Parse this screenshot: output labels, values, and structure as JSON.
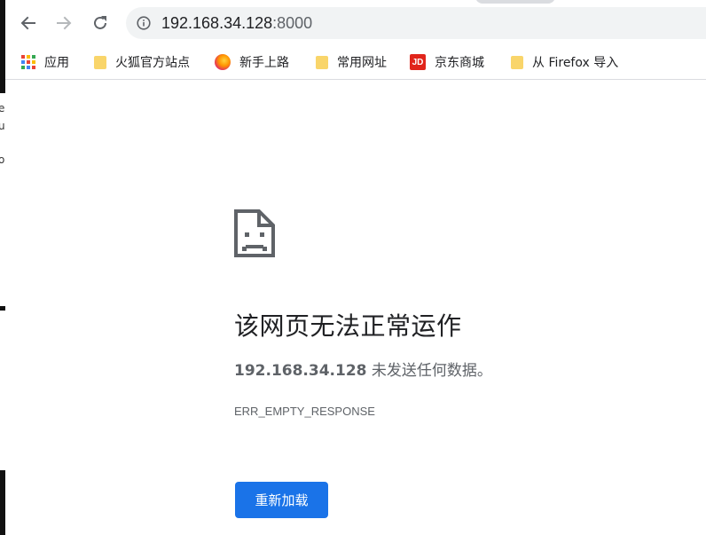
{
  "left_strip": {
    "glyphs": [
      "e",
      "u",
      "o"
    ]
  },
  "toolbar": {
    "back_icon": "arrow-left-icon",
    "forward_icon": "arrow-right-icon",
    "reload_icon": "reload-icon",
    "info_icon": "info-circle-icon",
    "url_host": "192.168.34.128",
    "url_port": ":8000"
  },
  "bookmarks": [
    {
      "label": "应用",
      "icon": "apps-grid-icon"
    },
    {
      "label": "火狐官方站点",
      "icon": "folder-icon"
    },
    {
      "label": "新手上路",
      "icon": "firefox-icon"
    },
    {
      "label": "常用网址",
      "icon": "folder-icon"
    },
    {
      "label": "京东商城",
      "icon": "jd-icon",
      "icon_text": "JD"
    },
    {
      "label": "从 Firefox 导入",
      "icon": "folder-icon"
    }
  ],
  "error": {
    "icon": "sad-document-icon",
    "title": "该网页无法正常运作",
    "host": "192.168.34.128",
    "message": " 未发送任何数据。",
    "code": "ERR_EMPTY_RESPONSE",
    "reload_label": "重新加载"
  },
  "colors": {
    "accent": "#1a73e8",
    "omnibox_bg": "#f1f3f4",
    "text_secondary": "#5f6368",
    "folder": "#f9d56a",
    "jd_red": "#e1251b"
  }
}
